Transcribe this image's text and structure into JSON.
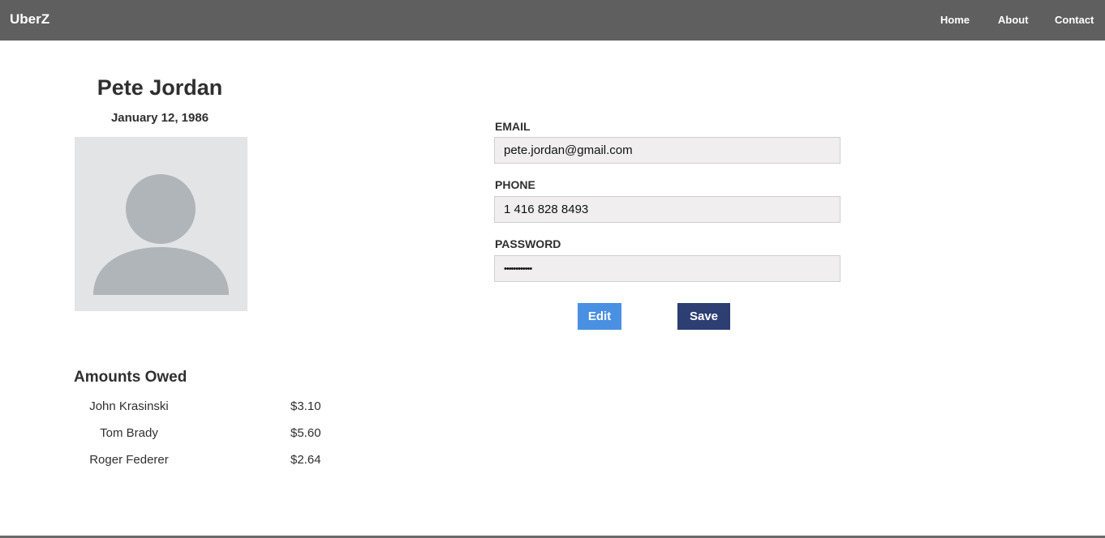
{
  "navbar": {
    "brand": "UberZ",
    "links": [
      "Home",
      "About",
      "Contact"
    ]
  },
  "profile": {
    "name": "Pete Jordan",
    "dob": "January 12, 1986"
  },
  "form": {
    "email_label": "EMAIL",
    "email_value": "pete.jordan@gmail.com",
    "phone_label": "PHONE",
    "phone_value": "1 416 828 8493",
    "password_label": "PASSWORD",
    "password_value": "••••••••••••",
    "edit_label": "Edit",
    "save_label": "Save"
  },
  "owed": {
    "title": "Amounts Owed",
    "rows": [
      {
        "name": "John Krasinski",
        "amount": "$3.10"
      },
      {
        "name": "Tom Brady",
        "amount": "$5.60"
      },
      {
        "name": "Roger Federer",
        "amount": "$2.64"
      }
    ]
  },
  "colors": {
    "navbar": "#5f5f5f",
    "edit_button": "#4a90e2",
    "save_button": "#2d3e73",
    "avatar_bg": "#e2e4e6",
    "avatar_figure": "#b0b5b9"
  }
}
